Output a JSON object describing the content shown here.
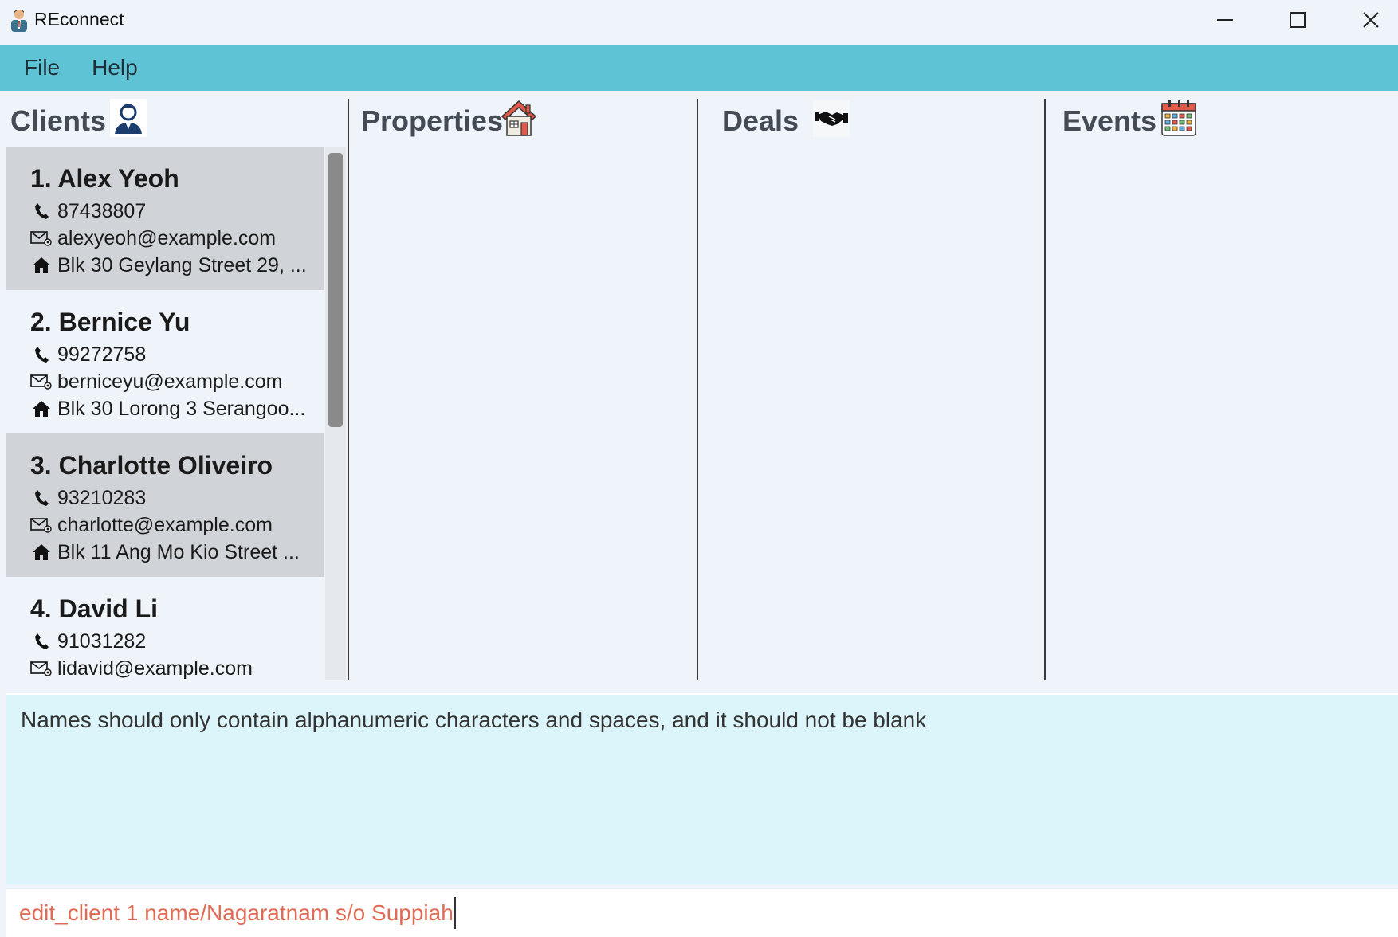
{
  "window": {
    "title": "REconnect"
  },
  "menu": {
    "items": [
      "File",
      "Help"
    ]
  },
  "columns": {
    "clients_title": "Clients",
    "properties_title": "Properties",
    "deals_title": "Deals",
    "events_title": "Events"
  },
  "clients": [
    {
      "name": "1. Alex Yeoh",
      "phone": "87438807",
      "email": "alexyeoh@example.com",
      "address": "Blk 30 Geylang Street 29, ..."
    },
    {
      "name": "2. Bernice Yu",
      "phone": "99272758",
      "email": "berniceyu@example.com",
      "address": "Blk 30 Lorong 3 Serangoo..."
    },
    {
      "name": "3. Charlotte Oliveiro",
      "phone": "93210283",
      "email": "charlotte@example.com",
      "address": "Blk 11 Ang Mo Kio Street ..."
    },
    {
      "name": "4. David Li",
      "phone": "91031282",
      "email": "lidavid@example.com",
      "address": ""
    }
  ],
  "result": {
    "message": "Names should only contain alphanumeric characters and spaces, and it should not be blank"
  },
  "command": {
    "value": "edit_client 1 name/Nagaratnam s/o Suppiah"
  },
  "colors": {
    "menubar": "#5fc3d6",
    "background": "#eef4fa",
    "selected_card": "#d0d4d9",
    "result_bg": "#dcf5fb",
    "command_text": "#e06b55"
  },
  "icons": {
    "app": "realtor-avatar-icon",
    "clients": "person-icon",
    "properties": "house-icon",
    "deals": "handshake-icon",
    "events": "calendar-icon",
    "phone": "phone-icon",
    "email": "email-icon",
    "address": "home-icon"
  }
}
